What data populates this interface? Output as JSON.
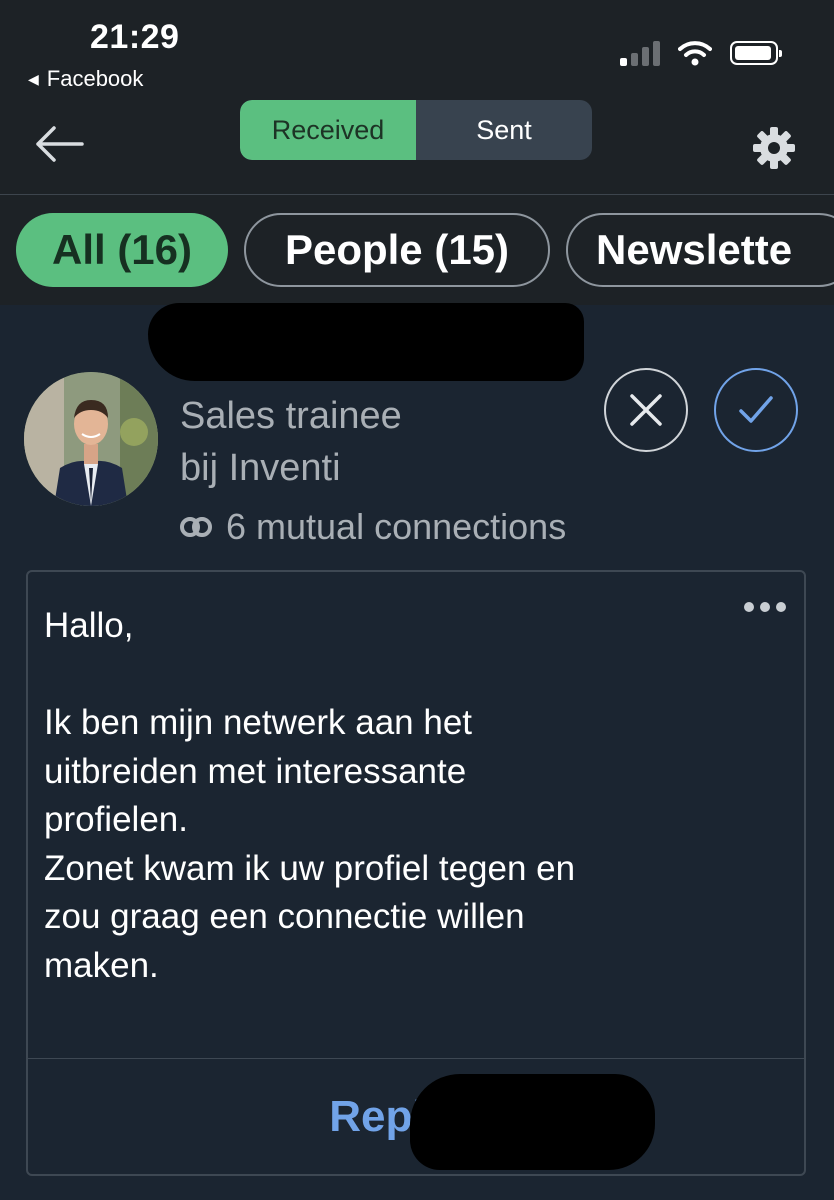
{
  "status_bar": {
    "time": "21:29",
    "back_app_label": "Facebook",
    "icons": [
      "cellular-signal-icon",
      "wifi-icon",
      "battery-icon"
    ]
  },
  "header": {
    "segments": [
      {
        "label": "Received",
        "selected": true
      },
      {
        "label": "Sent",
        "selected": false
      }
    ],
    "icons": [
      "back-arrow-icon",
      "gear-icon"
    ]
  },
  "filters": [
    {
      "label": "All (16)",
      "selected": true
    },
    {
      "label": "People (15)",
      "selected": false
    },
    {
      "label": "Newslette",
      "selected": false
    }
  ],
  "invitation": {
    "headline_line1": "Sales trainee",
    "headline_line2": "bij Inventi",
    "mutual": "6 mutual connections",
    "message": "Hallo,\n\nIk ben mijn netwerk aan het\nuitbreiden met interessante\nprofielen.\nZonet kwam ik uw profiel tegen en\nzou graag een connectie willen\nmaken.",
    "reply_label": "Reply to"
  },
  "colors": {
    "accent_green": "#5bbf80",
    "link_blue": "#71a3e8",
    "background": "#1b2531",
    "header_bg": "#1d2226"
  }
}
